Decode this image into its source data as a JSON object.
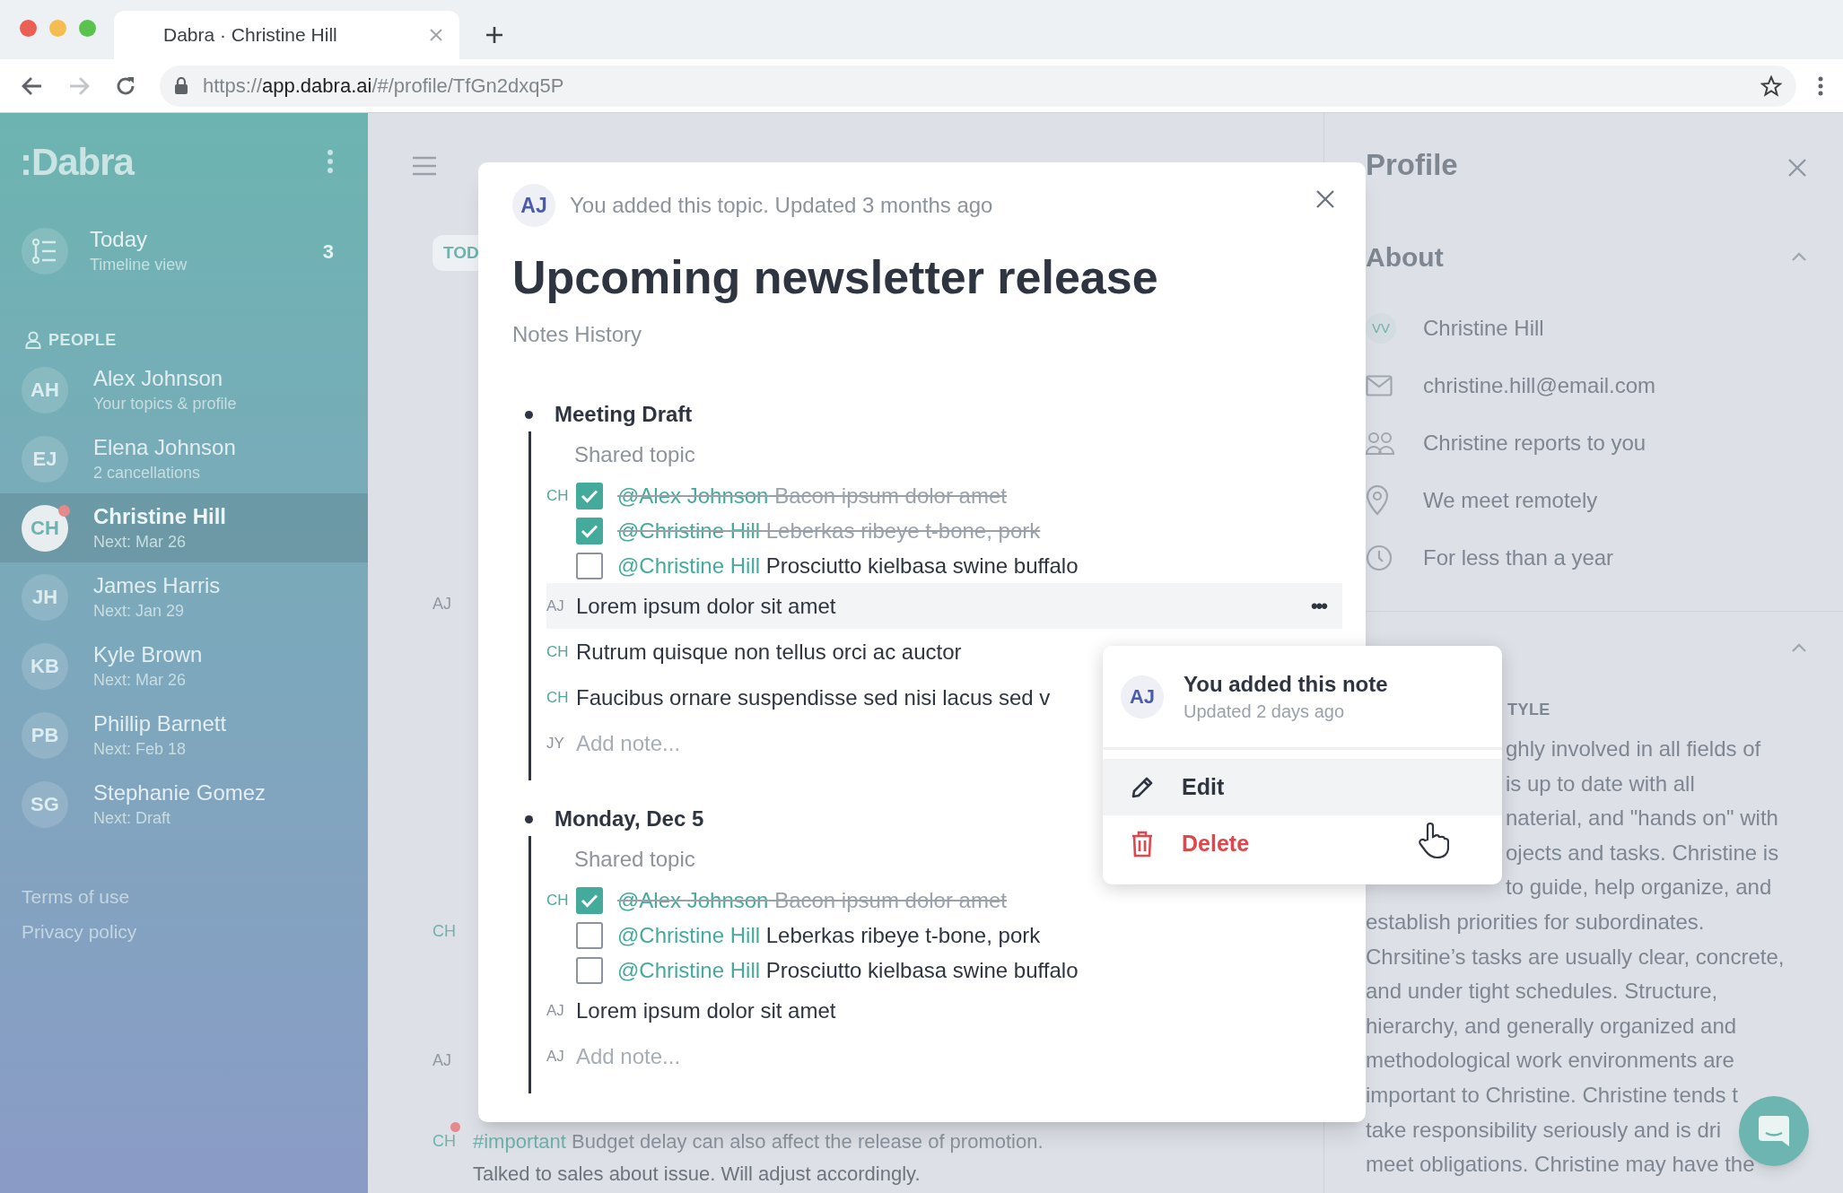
{
  "browser": {
    "tab_title": "Dabra · Christine Hill",
    "url": {
      "scheme": "https://",
      "host": "app.dabra.ai",
      "path": "/#/profile/TfGn2dxq5P"
    }
  },
  "sidebar": {
    "logo": ":Dabra",
    "today": {
      "label": "Today",
      "sub": "Timeline view",
      "count": "3"
    },
    "section": "PEOPLE",
    "people": [
      {
        "initials": "AH",
        "name": "Alex Johnson",
        "sub": "Your topics & profile",
        "selected": false,
        "alert": false
      },
      {
        "initials": "EJ",
        "name": "Elena Johnson",
        "sub": "2 cancellations",
        "selected": false,
        "alert": false
      },
      {
        "initials": "CH",
        "name": "Christine Hill",
        "sub": "Next: Mar 26",
        "selected": true,
        "alert": true
      },
      {
        "initials": "JH",
        "name": "James Harris",
        "sub": "Next: Jan 29",
        "selected": false,
        "alert": false
      },
      {
        "initials": "KB",
        "name": "Kyle Brown",
        "sub": "Next: Mar 26",
        "selected": false,
        "alert": false
      },
      {
        "initials": "PB",
        "name": "Phillip Barnett",
        "sub": "Next: Feb 18",
        "selected": false,
        "alert": false
      },
      {
        "initials": "SG",
        "name": "Stephanie Gomez",
        "sub": "Next: Draft",
        "selected": false,
        "alert": false
      }
    ],
    "links": [
      "Terms of use",
      "Privacy policy"
    ]
  },
  "timeline": {
    "chip": "TOD",
    "authors": [
      {
        "initials": "AJ",
        "alert": false
      },
      {
        "initials": "CH",
        "alert": false
      },
      {
        "initials": "AJ",
        "alert": false
      },
      {
        "initials": "CH",
        "alert": true
      }
    ],
    "last_note": {
      "tag": "#important",
      "text": "Budget delay can also affect the release of promotion.",
      "line2": "Talked to sales about issue. Will adjust accordingly."
    }
  },
  "modal": {
    "avatar": "AJ",
    "meta": "You added this topic. Updated 3 months ago",
    "title": "Upcoming newsletter release",
    "tab": "Notes History",
    "sections": [
      {
        "title": "Meeting Draft",
        "subtitle": "Shared topic",
        "rows": [
          {
            "kind": "task",
            "author": "CH",
            "checked": true,
            "mention": "@Alex Johnson",
            "text": "Bacon ipsum dolor amet"
          },
          {
            "kind": "task",
            "checked": true,
            "mention": "@Christine Hill",
            "text": "Leberkas ribeye t-bone, pork"
          },
          {
            "kind": "task",
            "checked": false,
            "mention": "@Christine Hill",
            "text": "Prosciutto kielbasa swine buffalo"
          },
          {
            "kind": "note",
            "author": "AJ",
            "text": "Lorem ipsum dolor sit amet",
            "highlighted": true,
            "more": "•••"
          },
          {
            "kind": "note",
            "author": "CH",
            "text": "Rutrum quisque non tellus orci ac auctor",
            "highlighted": false
          },
          {
            "kind": "note",
            "author": "CH",
            "text": "Faucibus ornare suspendisse sed nisi lacus sed v",
            "highlighted": false
          },
          {
            "kind": "add",
            "author": "JY",
            "placeholder": "Add note..."
          }
        ]
      },
      {
        "title": "Monday, Dec 5",
        "subtitle": "Shared topic",
        "rows": [
          {
            "kind": "task",
            "author": "CH",
            "checked": true,
            "mention": "@Alex Johnson",
            "text": "Bacon ipsum dolor amet"
          },
          {
            "kind": "task",
            "checked": false,
            "mention": "@Christine Hill",
            "text": "Leberkas ribeye t-bone, pork"
          },
          {
            "kind": "task",
            "checked": false,
            "mention": "@Christine Hill",
            "text": "Prosciutto kielbasa swine buffalo"
          },
          {
            "kind": "note",
            "author": "AJ",
            "text": "Lorem ipsum dolor sit amet",
            "highlighted": false
          },
          {
            "kind": "add",
            "author": "AJ",
            "placeholder": "Add note..."
          }
        ]
      }
    ]
  },
  "menu": {
    "avatar": "AJ",
    "title": "You added this note",
    "sub": "Updated 2 days ago",
    "items": [
      {
        "label": "Edit",
        "kind": "edit",
        "highlighted": true
      },
      {
        "label": "Delete",
        "kind": "delete",
        "highlighted": false
      }
    ]
  },
  "profile": {
    "title": "Profile",
    "about": "About",
    "about_rows": [
      {
        "kind": "avatar",
        "initials": "VV",
        "text": "Christine Hill"
      },
      {
        "kind": "email",
        "text": "christine.hill@email.com"
      },
      {
        "kind": "people",
        "text": "Christine reports to you"
      },
      {
        "kind": "location",
        "text": "We meet remotely"
      },
      {
        "kind": "time",
        "text": "For less than a year"
      }
    ],
    "style_label": "TYLE",
    "lines": [
      {
        "kind": "beside",
        "text": "ghly involved in all fields of"
      },
      {
        "kind": "beside",
        "text": "is up to date with all"
      },
      {
        "kind": "beside",
        "text": "naterial, and \"hands on\" with"
      },
      {
        "kind": "beside",
        "text": "ojects and tasks. Christine is"
      },
      {
        "kind": "beside",
        "text": "to guide, help organize, and"
      },
      {
        "kind": "full",
        "text": "establish priorities for subordinates."
      },
      {
        "kind": "full",
        "text": "Chrsitine’s tasks are usually clear, concrete,"
      },
      {
        "kind": "full",
        "text": "and under tight schedules. Structure,"
      },
      {
        "kind": "full",
        "text": "hierarchy, and generally organized and"
      },
      {
        "kind": "full",
        "text": "methodological work environments are"
      },
      {
        "kind": "full",
        "text": "important to Christine. Christine tends t"
      },
      {
        "kind": "full",
        "text": "take responsibility seriously and is dri"
      },
      {
        "kind": "full",
        "text": "meet obligations. Christine may have the"
      }
    ]
  }
}
